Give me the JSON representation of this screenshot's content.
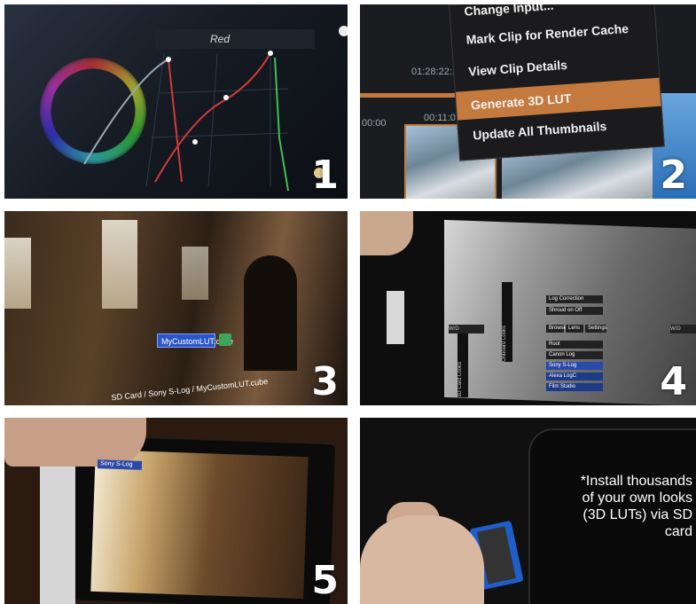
{
  "panels": [
    {
      "number": "1",
      "curve_label": "Red"
    },
    {
      "number": "2",
      "menu_items": [
        "Change Input...",
        "Mark Clip for Render Cache",
        "View Clip Details",
        "Generate 3D LUT",
        "Update All Thumbnails"
      ],
      "selected_item": "Generate 3D LUT",
      "timecodes": [
        "01:28:22:15",
        "00:11:0",
        "00:00"
      ]
    },
    {
      "number": "3",
      "filename": "MyCustomLUT.cube",
      "path": "SD Card / Sony S-Log / MyCustomLUT.cube"
    },
    {
      "number": "4",
      "menu": {
        "row1": "Log Correction",
        "row2": "Shroud on Off",
        "tabs": [
          "Browse",
          "Lens",
          "Settings"
        ],
        "list": [
          "Root",
          "Canon Log",
          "Sony S-Log",
          "Alexa LogC",
          "Film Studio"
        ],
        "selected": "Sony S-Log"
      },
      "side_label": "3D Card Looks",
      "side_label2": "Onboard Looks",
      "left_tag": "W/D",
      "right_tag": "W/D"
    },
    {
      "number": "5",
      "selected": "Sony S-Log"
    },
    {
      "number": "",
      "promo": "*Install thousands\nof your own looks\n(3D LUTs) via SD\ncard"
    }
  ],
  "colors": {
    "accent_orange": "#c47a3f",
    "selection_blue": "#2c55c9",
    "red_curve": "#d43a3a",
    "green_curve": "#3fbf5a"
  }
}
